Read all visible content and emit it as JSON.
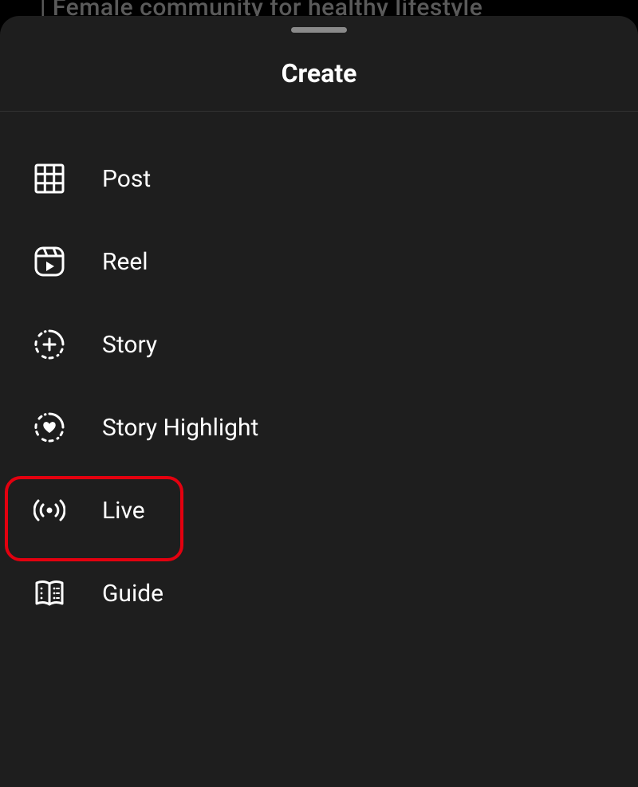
{
  "background": {
    "partial_text": "| Female community for healthy lifestyle"
  },
  "sheet": {
    "title": "Create",
    "items": [
      {
        "label": "Post",
        "icon": "grid-icon"
      },
      {
        "label": "Reel",
        "icon": "reel-icon"
      },
      {
        "label": "Story",
        "icon": "story-plus-icon"
      },
      {
        "label": "Story Highlight",
        "icon": "story-heart-icon"
      },
      {
        "label": "Live",
        "icon": "live-icon"
      },
      {
        "label": "Guide",
        "icon": "guide-icon"
      }
    ]
  },
  "annotation": {
    "highlighted_item": "Live",
    "highlight_color": "#e3000f"
  }
}
